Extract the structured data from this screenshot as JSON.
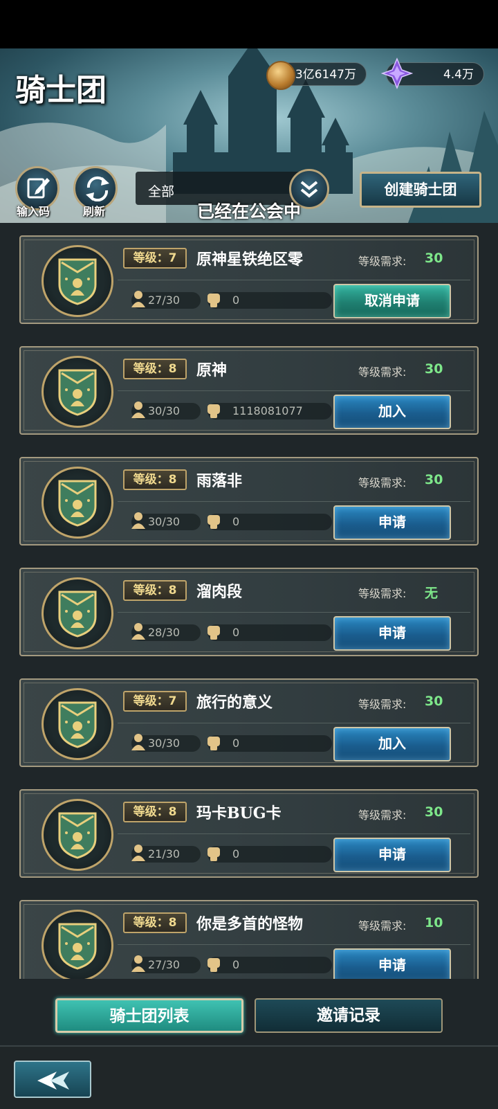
{
  "header": {
    "title": "骑士团",
    "coins": "3亿6147万",
    "gems": "4.4万",
    "input_code_label": "输入码",
    "refresh_label": "刷新",
    "filter_value": "全部",
    "toast": "已经在公会中",
    "create_button": "创建骑士团"
  },
  "guilds": [
    {
      "level": "等级：7",
      "name": "原神星铁绝区零",
      "req_label": "等级需求:",
      "req_value": "30",
      "members": "27/30",
      "power": "0",
      "action": "取消申请",
      "action_type": "cancel"
    },
    {
      "level": "等级：8",
      "name": "原神",
      "req_label": "等级需求:",
      "req_value": "30",
      "members": "30/30",
      "power": "1118081077",
      "action": "加入",
      "action_type": "join"
    },
    {
      "level": "等级：8",
      "name": "雨落非",
      "req_label": "等级需求:",
      "req_value": "30",
      "members": "30/30",
      "power": "0",
      "action": "申请",
      "action_type": "apply"
    },
    {
      "level": "等级：8",
      "name": "溜肉段",
      "req_label": "等级需求:",
      "req_value": "无",
      "members": "28/30",
      "power": "0",
      "action": "申请",
      "action_type": "apply"
    },
    {
      "level": "等级：7",
      "name": "旅行的意义",
      "req_label": "等级需求:",
      "req_value": "30",
      "members": "30/30",
      "power": "0",
      "action": "加入",
      "action_type": "join"
    },
    {
      "level": "等级：8",
      "name": "玛卡BUG卡",
      "req_label": "等级需求:",
      "req_value": "30",
      "members": "21/30",
      "power": "0",
      "action": "申请",
      "action_type": "apply"
    },
    {
      "level": "等级：8",
      "name": "你是多首的怪物",
      "req_label": "等级需求:",
      "req_value": "10",
      "members": "27/30",
      "power": "0",
      "action": "申请",
      "action_type": "apply"
    }
  ],
  "tabs": {
    "list_label": "骑士团列表",
    "invites_label": "邀请记录"
  },
  "colors": {
    "accent_green": "#7ee78a",
    "button_blue": "#1a5d8e",
    "button_teal": "#1f7f70",
    "gold_border": "#bfa46a"
  }
}
